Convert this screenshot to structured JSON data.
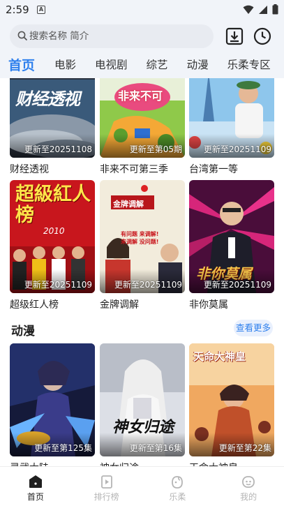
{
  "status": {
    "time": "2:59",
    "app_icon": "A"
  },
  "search": {
    "placeholder": "搜索名称 简介"
  },
  "tabs": [
    "首页",
    "电影",
    "电视剧",
    "综艺",
    "动漫",
    "乐柔专区"
  ],
  "shows_top": [
    {
      "title": "财经透视",
      "badge": "更新至20251108",
      "art_text": "财经透视"
    },
    {
      "title": "非来不可第三季",
      "badge": "更新至第05期",
      "art_text": "非来不可"
    },
    {
      "title": "台湾第一等",
      "badge": "更新至20251109",
      "art_text": ""
    }
  ],
  "shows_mid": [
    {
      "title": "超级红人榜",
      "badge": "更新至20251109",
      "art_text": "超級紅人榜",
      "art_year": "2010"
    },
    {
      "title": "金牌调解",
      "badge": "更新至20251109",
      "art_text": "金牌调解",
      "art_lines": [
        "有问题 来调解!",
        "来调解 没问题!"
      ]
    },
    {
      "title": "非你莫属",
      "badge": "更新至20251109",
      "art_text": "非你莫属"
    }
  ],
  "section_anime": {
    "title": "动漫",
    "more": "查看更多"
  },
  "shows_anime": [
    {
      "title": "灵武大陆",
      "badge": "更新至第125集"
    },
    {
      "title": "神女归途",
      "badge": "更新至第16集",
      "art_text": "神女归途"
    },
    {
      "title": "天命大神皇",
      "badge": "更新至第22集",
      "art_text": "天命大神皇"
    }
  ],
  "nav": [
    {
      "label": "首页",
      "icon": "home-icon",
      "active": true
    },
    {
      "label": "排行榜",
      "icon": "ranking-icon",
      "active": false
    },
    {
      "label": "乐柔",
      "icon": "lerou-icon",
      "active": false
    },
    {
      "label": "我的",
      "icon": "profile-icon",
      "active": false
    }
  ],
  "colors": {
    "accent": "#2f80ed",
    "header_bg": "#f1f4f9"
  }
}
